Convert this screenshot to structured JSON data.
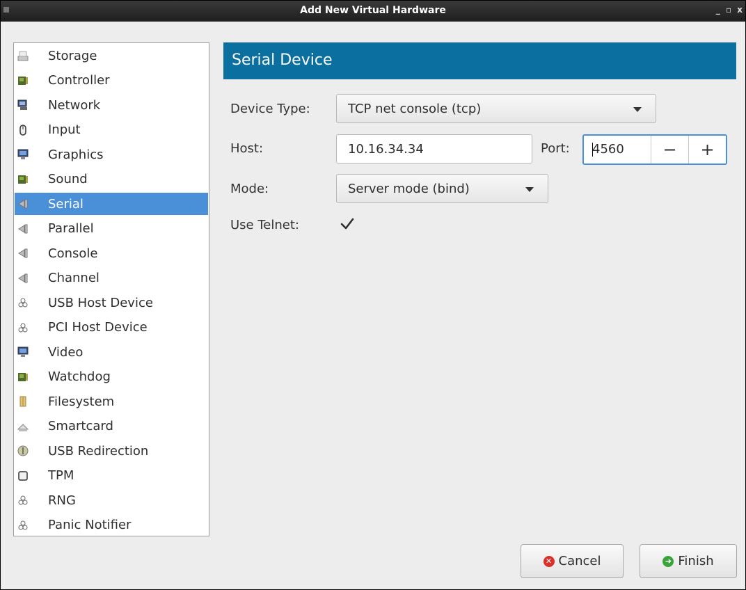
{
  "window": {
    "title": "Add New Virtual Hardware",
    "controls": "_ ▫ x"
  },
  "hardware_list": {
    "selected_index": 6,
    "items": [
      {
        "label": "Storage",
        "icon": "storage-icon"
      },
      {
        "label": "Controller",
        "icon": "controller-icon"
      },
      {
        "label": "Network",
        "icon": "network-icon"
      },
      {
        "label": "Input",
        "icon": "mouse-icon"
      },
      {
        "label": "Graphics",
        "icon": "monitor-icon"
      },
      {
        "label": "Sound",
        "icon": "sound-card-icon"
      },
      {
        "label": "Serial",
        "icon": "serial-port-icon"
      },
      {
        "label": "Parallel",
        "icon": "parallel-port-icon"
      },
      {
        "label": "Console",
        "icon": "console-port-icon"
      },
      {
        "label": "Channel",
        "icon": "channel-port-icon"
      },
      {
        "label": "USB Host Device",
        "icon": "usb-device-icon"
      },
      {
        "label": "PCI Host Device",
        "icon": "pci-device-icon"
      },
      {
        "label": "Video",
        "icon": "video-icon"
      },
      {
        "label": "Watchdog",
        "icon": "watchdog-icon"
      },
      {
        "label": "Filesystem",
        "icon": "filesystem-icon"
      },
      {
        "label": "Smartcard",
        "icon": "smartcard-icon"
      },
      {
        "label": "USB Redirection",
        "icon": "usb-redirection-icon"
      },
      {
        "label": "TPM",
        "icon": "tpm-chip-icon"
      },
      {
        "label": "RNG",
        "icon": "rng-icon"
      },
      {
        "label": "Panic Notifier",
        "icon": "panic-notifier-icon"
      }
    ]
  },
  "serial_device": {
    "header": "Serial Device",
    "device_type_label": "Device Type:",
    "device_type_value": "TCP net console (tcp)",
    "host_label": "Host:",
    "host_value": "10.16.34.34",
    "port_label": "Port:",
    "port_value": "4560",
    "port_decrement": "−",
    "port_increment": "+",
    "mode_label": "Mode:",
    "mode_value": "Server mode (bind)",
    "use_telnet_label": "Use Telnet:",
    "use_telnet_checked": true
  },
  "buttons": {
    "cancel": "Cancel",
    "finish": "Finish"
  },
  "colors": {
    "header_bg": "#0b6fa0",
    "selection_bg": "#4a90d9",
    "cancel_icon": "#d9312a",
    "finish_icon": "#3aa33a"
  }
}
